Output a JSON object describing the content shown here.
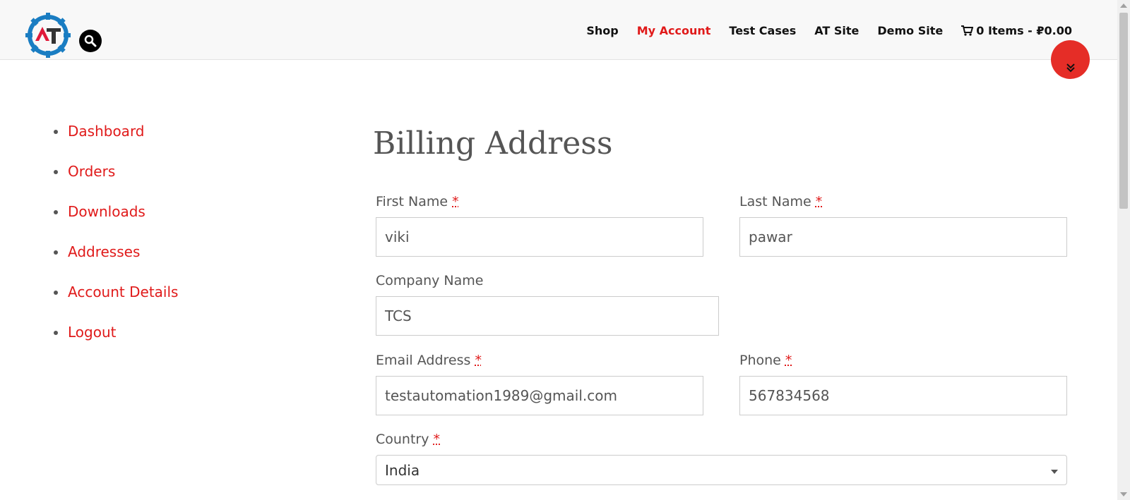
{
  "header": {
    "nav": [
      "Shop",
      "My Account",
      "Test Cases",
      "AT Site",
      "Demo Site"
    ],
    "active_nav": "My Account",
    "cart_label": "0 Items - ₽0.00",
    "logo_letters": "AT"
  },
  "sidebar": {
    "items": [
      "Dashboard",
      "Orders",
      "Downloads",
      "Addresses",
      "Account Details",
      "Logout"
    ]
  },
  "form": {
    "title": "Billing Address",
    "first_name": {
      "label": "First Name",
      "value": "viki"
    },
    "last_name": {
      "label": "Last Name",
      "value": "pawar"
    },
    "company": {
      "label": "Company Name",
      "value": "TCS"
    },
    "email": {
      "label": "Email Address",
      "value": "testautomation1989@gmail.com"
    },
    "phone": {
      "label": "Phone",
      "value": "567834568"
    },
    "country": {
      "label": "Country",
      "value": "India"
    },
    "required_marker": "*"
  },
  "colors": {
    "accent": "#e01a1a",
    "scroll_button": "#e52d27",
    "logo_blue": "#1a7dc2"
  },
  "icons": [
    "search-icon",
    "cart-icon",
    "double-chevron-down-icon",
    "gear-logo-icon"
  ]
}
